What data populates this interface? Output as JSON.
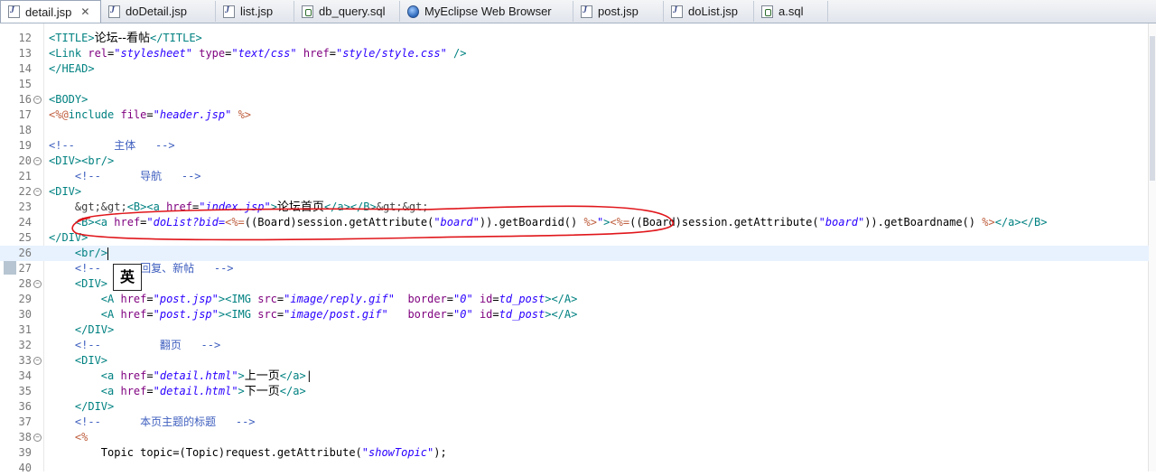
{
  "tabs": [
    {
      "label": "detail.jsp",
      "icon": "jsp-file-icon",
      "active": true,
      "closable": true
    },
    {
      "label": "doDetail.jsp",
      "icon": "jsp-file-icon"
    },
    {
      "label": "list.jsp",
      "icon": "jsp-file-icon"
    },
    {
      "label": "db_query.sql",
      "icon": "sql-file-icon"
    },
    {
      "label": "MyEclipse Web Browser",
      "icon": "web-browser-icon"
    },
    {
      "label": "post.jsp",
      "icon": "jsp-file-icon"
    },
    {
      "label": "doList.jsp",
      "icon": "jsp-file-icon"
    },
    {
      "label": "a.sql",
      "icon": "sql-file-icon"
    }
  ],
  "tab_close_glyph": "✕",
  "tab_list_menu_glyph": "▾▾",
  "ime_indicator": "英",
  "editor": {
    "current_line": 26,
    "lines": [
      {
        "n": "12",
        "fold": false,
        "indent": "",
        "tokens": [
          [
            "tag",
            "<TITLE>"
          ],
          [
            "txt",
            "论坛--看帖"
          ],
          [
            "tag",
            "</TITLE>"
          ]
        ]
      },
      {
        "n": "13",
        "fold": false,
        "indent": "",
        "tokens": [
          [
            "tag",
            "<Link "
          ],
          [
            "attr",
            "rel"
          ],
          [
            "plain",
            "="
          ],
          [
            "val",
            "\"stylesheet\""
          ],
          [
            "plain",
            " "
          ],
          [
            "attr",
            "type"
          ],
          [
            "plain",
            "="
          ],
          [
            "val",
            "\"text/css\""
          ],
          [
            "plain",
            " "
          ],
          [
            "attr",
            "href"
          ],
          [
            "plain",
            "="
          ],
          [
            "val",
            "\"style/style.css\""
          ],
          [
            "plain",
            " "
          ],
          [
            "tag",
            "/>"
          ]
        ]
      },
      {
        "n": "14",
        "fold": false,
        "indent": "",
        "tokens": [
          [
            "tag",
            "</HEAD>"
          ]
        ]
      },
      {
        "n": "15",
        "fold": false,
        "indent": "",
        "tokens": []
      },
      {
        "n": "16",
        "fold": true,
        "indent": "",
        "tokens": [
          [
            "tag",
            "<BODY>"
          ]
        ]
      },
      {
        "n": "17",
        "fold": false,
        "indent": "",
        "tokens": [
          [
            "scr",
            "<%@"
          ],
          [
            "tag",
            "include "
          ],
          [
            "attr",
            "file"
          ],
          [
            "plain",
            "="
          ],
          [
            "val",
            "\"header.jsp\""
          ],
          [
            "plain",
            " "
          ],
          [
            "scr",
            "%>"
          ]
        ]
      },
      {
        "n": "18",
        "fold": false,
        "indent": "",
        "tokens": []
      },
      {
        "n": "19",
        "fold": false,
        "indent": "",
        "tokens": [
          [
            "cmt",
            "<!--      "
          ],
          [
            "cmt",
            "主体"
          ],
          [
            "cmt",
            "   -->"
          ]
        ]
      },
      {
        "n": "20",
        "fold": true,
        "indent": "",
        "tokens": [
          [
            "tag",
            "<DIV><br/>"
          ]
        ]
      },
      {
        "n": "21",
        "fold": false,
        "indent": "    ",
        "tokens": [
          [
            "cmt",
            "<!--      "
          ],
          [
            "cmt",
            "导航"
          ],
          [
            "cmt",
            "   -->"
          ]
        ]
      },
      {
        "n": "22",
        "fold": true,
        "indent": "",
        "tokens": [
          [
            "tag",
            "<DIV>"
          ]
        ]
      },
      {
        "n": "23",
        "fold": false,
        "indent": "    ",
        "tokens": [
          [
            "ent",
            "&gt;&gt;"
          ],
          [
            "tag",
            "<B><a "
          ],
          [
            "attr",
            "href"
          ],
          [
            "plain",
            "="
          ],
          [
            "val",
            "\"index.jsp\""
          ],
          [
            "tag",
            ">"
          ],
          [
            "txt",
            "论坛首页"
          ],
          [
            "tag",
            "</a></B>"
          ],
          [
            "ent",
            "&gt;&gt;"
          ]
        ]
      },
      {
        "n": "24",
        "fold": false,
        "indent": "    ",
        "tokens": [
          [
            "tag",
            "<B><a "
          ],
          [
            "attr",
            "href"
          ],
          [
            "plain",
            "="
          ],
          [
            "val",
            "\"doList?bid="
          ],
          [
            "scr",
            "<%="
          ],
          [
            "plain",
            "((Board)session.getAttribute("
          ],
          [
            "val2",
            "\"board\""
          ],
          [
            "plain",
            ")).getBoardid() "
          ],
          [
            "scr",
            "%>"
          ],
          [
            "val",
            "\""
          ],
          [
            "tag",
            ">"
          ],
          [
            "scr",
            "<%="
          ],
          [
            "plain",
            "((Board)session.getAttribute("
          ],
          [
            "val2",
            "\"board\""
          ],
          [
            "plain",
            ")).getBoardname() "
          ],
          [
            "scr",
            "%>"
          ],
          [
            "tag",
            "</a></B>"
          ]
        ]
      },
      {
        "n": "25",
        "fold": false,
        "indent": "",
        "tokens": [
          [
            "tag",
            "</DIV>"
          ]
        ]
      },
      {
        "n": "26",
        "fold": false,
        "indent": "    ",
        "tokens": [
          [
            "tag",
            "<br/>"
          ],
          [
            "caret",
            ""
          ]
        ]
      },
      {
        "n": "27",
        "fold": false,
        "indent": "    ",
        "tokens": [
          [
            "cmt",
            "<!--      "
          ],
          [
            "cmt",
            "回复、新帖"
          ],
          [
            "cmt",
            "   -->"
          ]
        ]
      },
      {
        "n": "28",
        "fold": true,
        "indent": "    ",
        "tokens": [
          [
            "tag",
            "<DIV>"
          ]
        ]
      },
      {
        "n": "29",
        "fold": false,
        "indent": "        ",
        "tokens": [
          [
            "tag",
            "<A "
          ],
          [
            "attr",
            "href"
          ],
          [
            "plain",
            "="
          ],
          [
            "val",
            "\"post.jsp\""
          ],
          [
            "tag",
            "><IMG "
          ],
          [
            "attr",
            "src"
          ],
          [
            "plain",
            "="
          ],
          [
            "val",
            "\"image/reply.gif\""
          ],
          [
            "plain",
            "  "
          ],
          [
            "attr",
            "border"
          ],
          [
            "plain",
            "="
          ],
          [
            "val2",
            "\"0\""
          ],
          [
            "plain",
            " "
          ],
          [
            "attr",
            "id"
          ],
          [
            "plain",
            "="
          ],
          [
            "val",
            "td_post"
          ],
          [
            "tag",
            "></A>"
          ]
        ]
      },
      {
        "n": "30",
        "fold": false,
        "indent": "        ",
        "tokens": [
          [
            "tag",
            "<A "
          ],
          [
            "attr",
            "href"
          ],
          [
            "plain",
            "="
          ],
          [
            "val",
            "\"post.jsp\""
          ],
          [
            "tag",
            "><IMG "
          ],
          [
            "attr",
            "src"
          ],
          [
            "plain",
            "="
          ],
          [
            "val",
            "\"image/post.gif\""
          ],
          [
            "plain",
            "   "
          ],
          [
            "attr",
            "border"
          ],
          [
            "plain",
            "="
          ],
          [
            "val2",
            "\"0\""
          ],
          [
            "plain",
            " "
          ],
          [
            "attr",
            "id"
          ],
          [
            "plain",
            "="
          ],
          [
            "val",
            "td_post"
          ],
          [
            "tag",
            "></A>"
          ]
        ]
      },
      {
        "n": "31",
        "fold": false,
        "indent": "    ",
        "tokens": [
          [
            "tag",
            "</DIV>"
          ]
        ]
      },
      {
        "n": "32",
        "fold": false,
        "indent": "    ",
        "tokens": [
          [
            "cmt",
            "<!--         "
          ],
          [
            "cmt",
            "翻页"
          ],
          [
            "cmt",
            "   -->"
          ]
        ]
      },
      {
        "n": "33",
        "fold": true,
        "indent": "    ",
        "tokens": [
          [
            "tag",
            "<DIV>"
          ]
        ]
      },
      {
        "n": "34",
        "fold": false,
        "indent": "        ",
        "tokens": [
          [
            "tag",
            "<a "
          ],
          [
            "attr",
            "href"
          ],
          [
            "plain",
            "="
          ],
          [
            "val",
            "\"detail.html\""
          ],
          [
            "tag",
            ">"
          ],
          [
            "txt",
            "上一页"
          ],
          [
            "tag",
            "</a>"
          ],
          [
            "plain",
            "|"
          ]
        ]
      },
      {
        "n": "35",
        "fold": false,
        "indent": "        ",
        "tokens": [
          [
            "tag",
            "<a "
          ],
          [
            "attr",
            "href"
          ],
          [
            "plain",
            "="
          ],
          [
            "val",
            "\"detail.html\""
          ],
          [
            "tag",
            ">"
          ],
          [
            "txt",
            "下一页"
          ],
          [
            "tag",
            "</a>"
          ]
        ]
      },
      {
        "n": "36",
        "fold": false,
        "indent": "    ",
        "tokens": [
          [
            "tag",
            "</DIV>"
          ]
        ]
      },
      {
        "n": "37",
        "fold": false,
        "indent": "    ",
        "tokens": [
          [
            "cmt",
            "<!--      "
          ],
          [
            "cmt",
            "本页主题的标题"
          ],
          [
            "cmt",
            "   -->"
          ]
        ]
      },
      {
        "n": "38",
        "fold": true,
        "indent": "    ",
        "tokens": [
          [
            "scr",
            "<%"
          ]
        ]
      },
      {
        "n": "39",
        "fold": false,
        "indent": "        ",
        "tokens": [
          [
            "plain",
            "Topic topic=(Topic)request.getAttribute("
          ],
          [
            "val2",
            "\"showTopic\""
          ],
          [
            "plain",
            ");"
          ]
        ]
      },
      {
        "n": "40",
        "fold": false,
        "indent": "",
        "tokens": []
      }
    ]
  },
  "colors": {
    "tag": "#008080",
    "attribute": "#7f007f",
    "string": "#2a00ff",
    "comment": "#3f5fbf",
    "scriptlet": "#bf5f3f",
    "current_line_bg": "#e8f2fe",
    "annotation_stroke": "#e0161b"
  }
}
